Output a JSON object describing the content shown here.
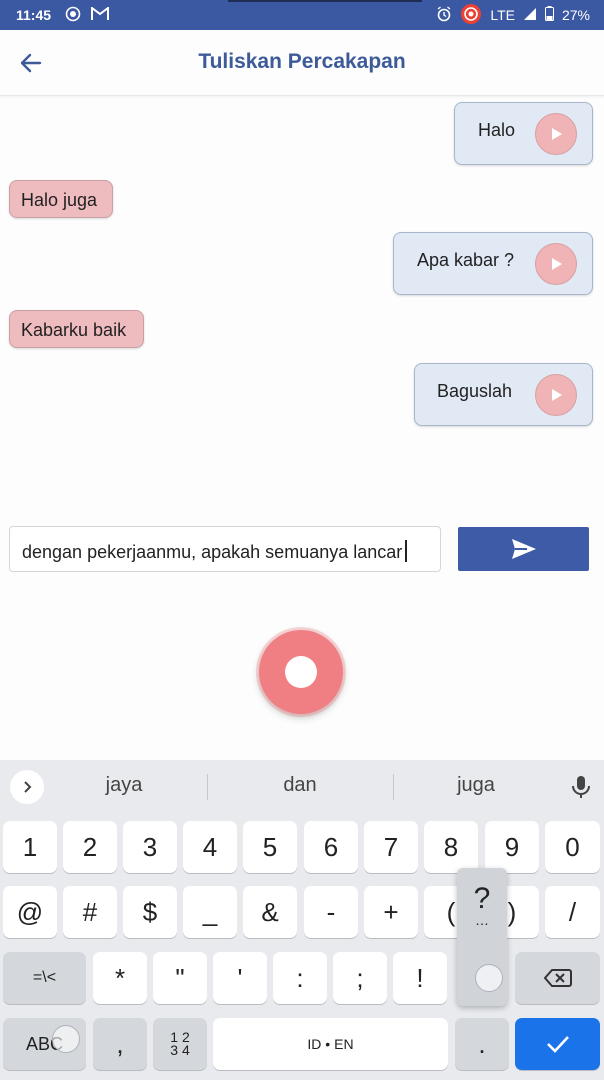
{
  "status_bar": {
    "time": "11:45",
    "network": "LTE",
    "battery": "27%"
  },
  "app_bar": {
    "title": "Tuliskan Percakapan",
    "back_icon": "arrow-left-icon"
  },
  "messages": [
    {
      "side": "right",
      "text": "Halo"
    },
    {
      "side": "left",
      "text": "Halo juga"
    },
    {
      "side": "right",
      "text": "Apa kabar ?"
    },
    {
      "side": "left",
      "text": "Kabarku baik"
    },
    {
      "side": "right",
      "text": "Baguslah"
    }
  ],
  "composer": {
    "value": "dengan pekerjaanmu, apakah semuanya lancar",
    "send_icon": "send-icon",
    "record_icon": "record-icon"
  },
  "keyboard": {
    "suggestions": [
      "jaya",
      "dan",
      "juga"
    ],
    "row1": [
      "1",
      "2",
      "3",
      "4",
      "5",
      "6",
      "7",
      "8",
      "9",
      "0"
    ],
    "row2": [
      "@",
      "#",
      "$",
      "_",
      "&",
      "-",
      "+",
      "(",
      ")",
      "/"
    ],
    "row3": [
      "=\\<",
      "*",
      "\"",
      "'",
      ":",
      ";",
      "!"
    ],
    "abc": "ABC",
    "comma": ",",
    "num_top": "1 2",
    "num_bottom": "3 4",
    "lang": "ID • EN",
    "period": ".",
    "popup_char": "?",
    "popup_ellipsis": "…"
  },
  "colors": {
    "primary": "#3d5ba6",
    "title": "#3d5a99",
    "bubble_right": "#e1e9f5",
    "bubble_left": "#eebbbf",
    "record": "#f07f83",
    "enter_key": "#1a73e8"
  }
}
